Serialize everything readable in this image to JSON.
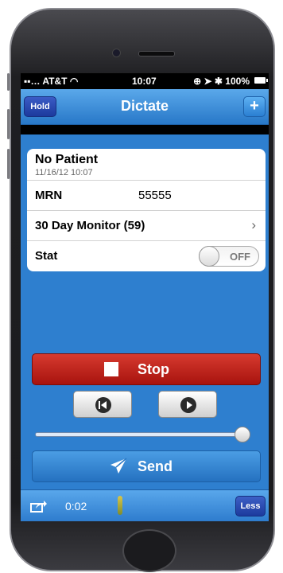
{
  "status_bar": {
    "carrier": "AT&T",
    "time": "10:07",
    "battery": "100%"
  },
  "navbar": {
    "title": "Dictate",
    "hold_label": "Hold",
    "add_label": "+"
  },
  "patient_card": {
    "patient_name": "No Patient",
    "patient_datetime": "11/16/12 10:07",
    "mrn_label": "MRN",
    "mrn_value": "55555",
    "monitor_label": "30 Day Monitor (59)",
    "stat_label": "Stat",
    "stat_toggle": "OFF"
  },
  "controls": {
    "stop_label": "Stop",
    "send_label": "Send",
    "slider_value": 1.0
  },
  "bottom_bar": {
    "elapsed_time": "0:02",
    "less_label": "Less"
  },
  "colors": {
    "background_blue": "#2e7fcf",
    "stop_red": "#c3251c",
    "hold_blue": "#2a4bb4"
  }
}
